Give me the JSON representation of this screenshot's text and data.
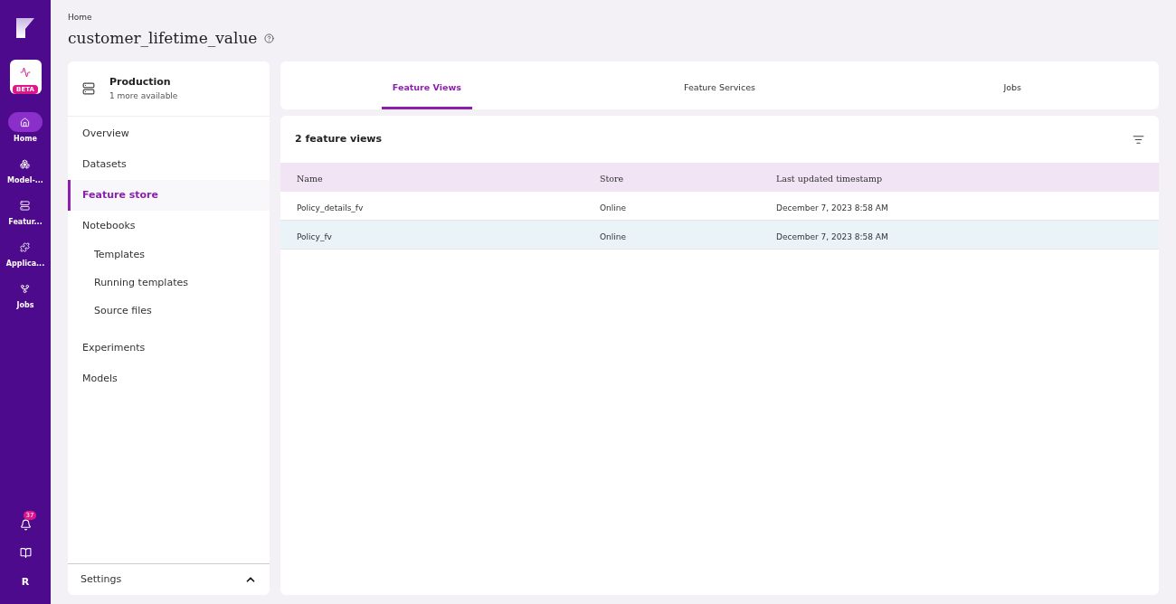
{
  "rail": {
    "badge": "BETA",
    "items": [
      {
        "label": "Home",
        "selected": true
      },
      {
        "label": "Model-...",
        "selected": false
      },
      {
        "label": "Featur...",
        "selected": false
      },
      {
        "label": "Applica...",
        "selected": false
      },
      {
        "label": "Jobs",
        "selected": false
      }
    ],
    "notifications": "37",
    "avatar": "R"
  },
  "breadcrumb": "Home",
  "title": "customer_lifetime_value",
  "project": {
    "name": "Production",
    "sub": "1 more available"
  },
  "nav": [
    {
      "label": "Overview",
      "selected": false
    },
    {
      "label": "Datasets",
      "selected": false
    },
    {
      "label": "Feature store",
      "selected": true
    },
    {
      "label": "Notebooks",
      "selected": false,
      "children": [
        {
          "label": "Templates",
          "selected": false
        },
        {
          "label": "Running templates",
          "selected": false
        },
        {
          "label": "Source files",
          "selected": false
        }
      ]
    },
    {
      "label": "Experiments",
      "selected": false
    },
    {
      "label": "Models",
      "selected": false
    }
  ],
  "settings": {
    "label": "Settings",
    "expanded": true
  },
  "tabs": [
    {
      "label": "Feature Views",
      "selected": true
    },
    {
      "label": "Feature Services",
      "selected": false
    },
    {
      "label": "Jobs",
      "selected": false
    }
  ],
  "table": {
    "title": "2 feature views",
    "columns": [
      "Name",
      "Store",
      "Last updated timestamp"
    ],
    "rows": [
      {
        "cells": [
          "Policy_details_fv",
          "Online",
          "December 7, 2023 8:58 AM"
        ],
        "selected": false
      },
      {
        "cells": [
          "Policy_fv",
          "Online",
          "December 7, 2023 8:58 AM"
        ],
        "selected": true
      }
    ]
  }
}
